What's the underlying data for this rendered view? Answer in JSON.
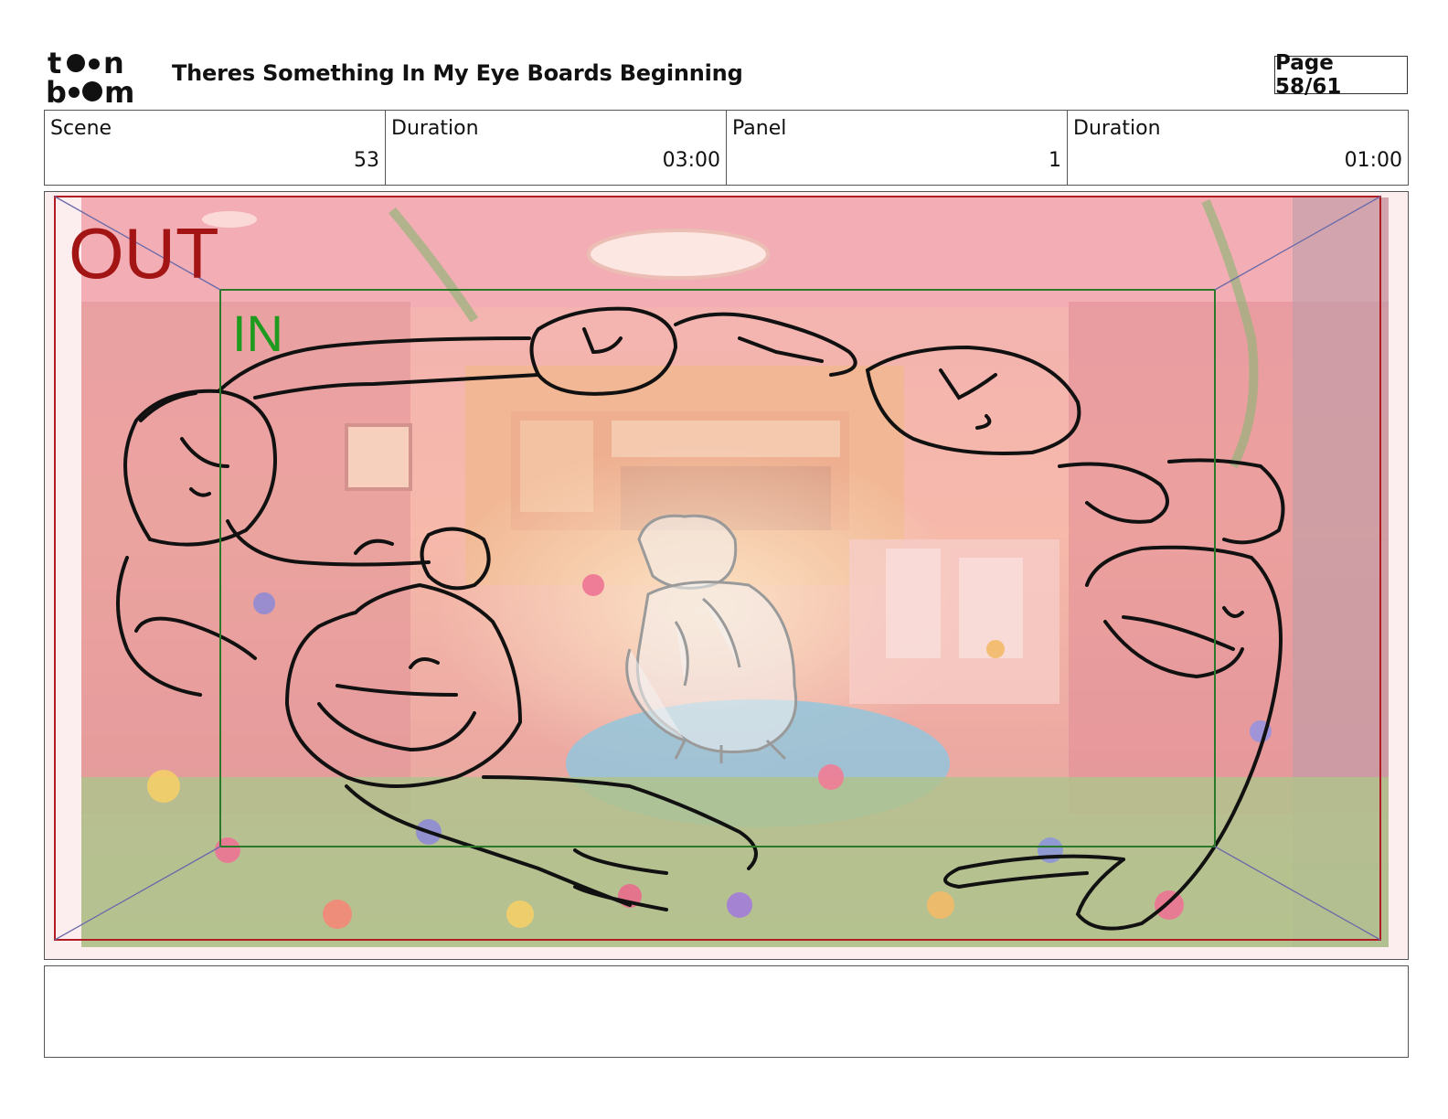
{
  "header": {
    "logo_text": "toonboom",
    "title": "Theres Something In My Eye Boards Beginning",
    "page": "Page 58/61"
  },
  "info": [
    {
      "label": "Scene",
      "value": "53"
    },
    {
      "label": "Duration",
      "value": "03:00"
    },
    {
      "label": "Panel",
      "value": "1"
    },
    {
      "label": "Duration",
      "value": "01:00"
    }
  ],
  "panel": {
    "out_label": "OUT",
    "in_label": "IN",
    "colors": {
      "out_frame": "#b01c22",
      "in_frame": "#2a7a2a",
      "tint": "#f07a8a",
      "rug": "#5cc8e8"
    }
  },
  "notes": {
    "text": ""
  }
}
